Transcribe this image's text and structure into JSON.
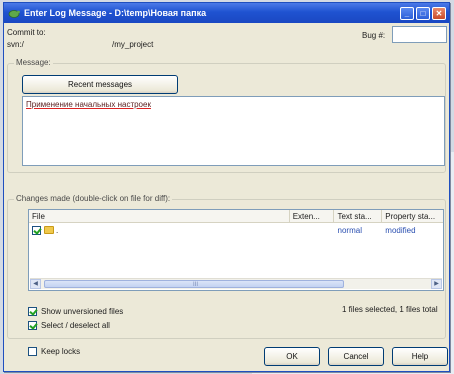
{
  "window": {
    "title": "Enter Log Message - D:\\temp\\Новая папка",
    "title_buttons": [
      "_",
      "□",
      "✕"
    ]
  },
  "commit": {
    "label": "Commit to:",
    "url_prefix": "svn:/",
    "url_suffix": "/my_project",
    "bug_label": "Bug #:",
    "bug_value": ""
  },
  "message": {
    "group_label": "Message:",
    "recent_button": "Recent messages",
    "text": "Применение начальных настроек"
  },
  "changes": {
    "group_label": "Changes made (double-click on file for diff):",
    "columns": [
      "File",
      "Exten...",
      "Text sta...",
      "Property sta..."
    ],
    "rows": [
      {
        "file": ".",
        "extension": "",
        "text_status": "normal",
        "property_status": "modified",
        "checked": true
      }
    ],
    "scroll_grip": "III",
    "show_unversioned_label": "Show unversioned files",
    "select_all_label": "Select / deselect all",
    "status_text": "1 files selected, 1 files total"
  },
  "footer": {
    "keep_locks_label": "Keep locks",
    "ok": "OK",
    "cancel": "Cancel",
    "help": "Help"
  },
  "colors": {
    "title_bar": "#1f53d1",
    "status_blue": "#2a4fb0"
  }
}
